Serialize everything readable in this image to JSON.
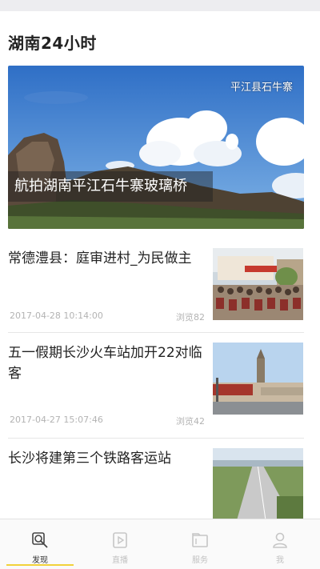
{
  "header": {
    "title": "湖南24小时"
  },
  "hero": {
    "location_label": "平江县石牛寨",
    "caption": "航拍湖南平江石牛寨玻璃桥"
  },
  "news": [
    {
      "headline": "常德澧县：庭审进村_为民做主",
      "date": "2017-04-28 10:14:00",
      "views": "浏览82"
    },
    {
      "headline": "五一假期长沙火车站加开22对临客",
      "date": "2017-04-27 15:07:46",
      "views": "浏览42"
    },
    {
      "headline": "长沙将建第三个铁路客运站",
      "date": "",
      "views": ""
    }
  ],
  "tabbar": {
    "items": [
      {
        "label": "发现",
        "icon": "search-icon",
        "active": true
      },
      {
        "label": "直播",
        "icon": "play-icon",
        "active": false
      },
      {
        "label": "服务",
        "icon": "folder-icon",
        "active": false
      },
      {
        "label": "我",
        "icon": "person-icon",
        "active": false
      }
    ],
    "accent_color": "#f2d23a"
  }
}
